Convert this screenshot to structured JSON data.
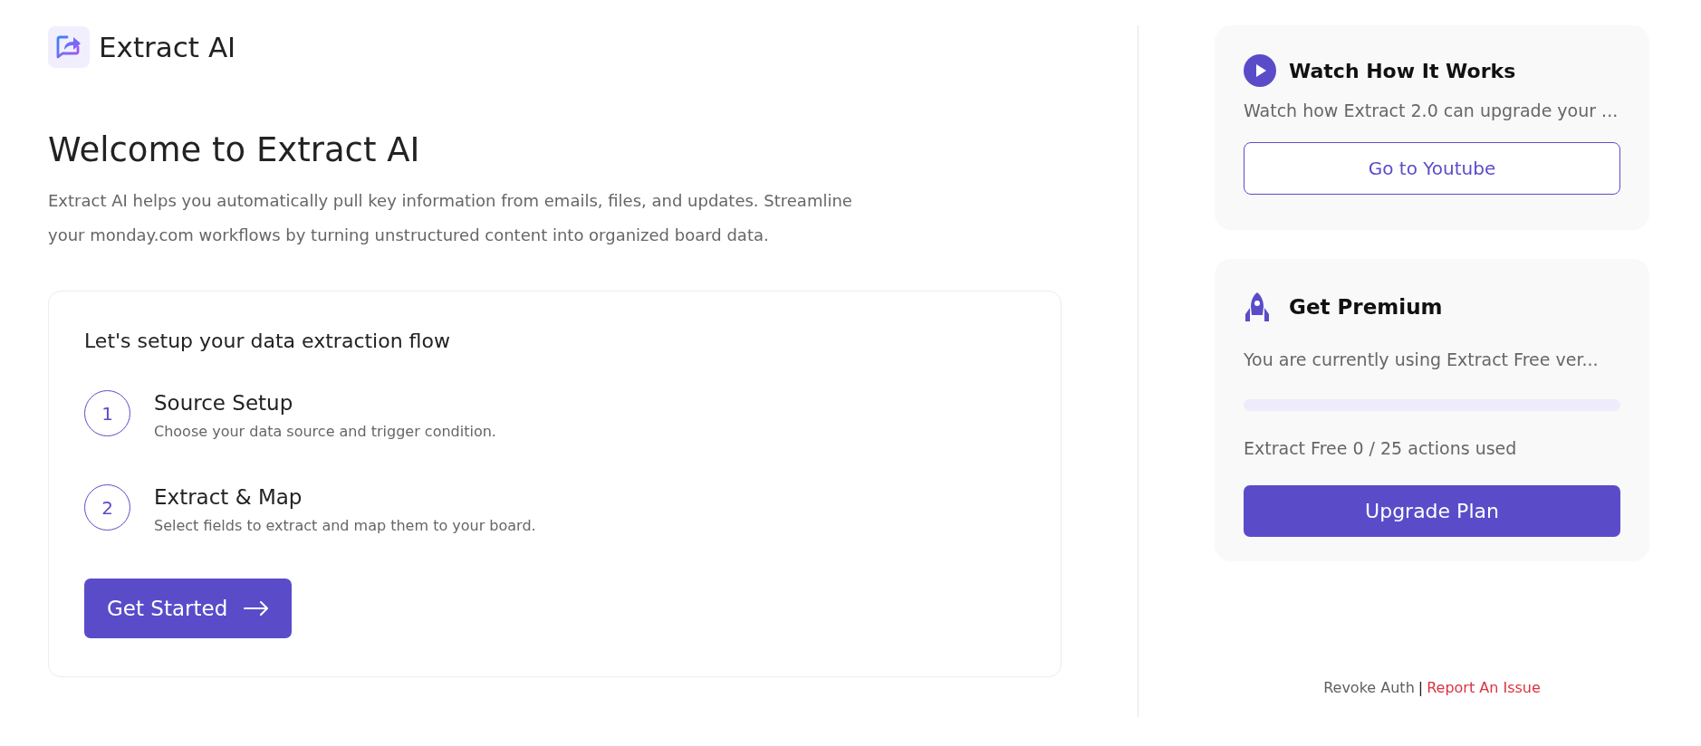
{
  "header": {
    "title": "Extract AI"
  },
  "intro": {
    "heading": "Welcome to Extract AI",
    "description": "Extract AI helps you automatically pull key information from emails, files, and updates. Streamline your monday.com workflows by turning unstructured content into organized board data."
  },
  "setup_card": {
    "title": "Let's setup your data extraction flow",
    "steps": [
      {
        "number": "1",
        "title": "Source Setup",
        "description": "Choose your data source and trigger condition."
      },
      {
        "number": "2",
        "title": "Extract & Map",
        "description": "Select fields to extract and map them to your board."
      }
    ],
    "button": "Get Started"
  },
  "video_card": {
    "title": "Watch How It Works",
    "description": "Watch how Extract 2.0 can upgrade your ...",
    "button": "Go to Youtube"
  },
  "premium_card": {
    "title": "Get Premium",
    "description": "You are currently using Extract Free ver...",
    "usage": {
      "level": 0
    },
    "usage_text": "Extract Free 0 / 25 actions used",
    "button": "Upgrade Plan"
  },
  "footer_links": [
    {
      "label": "Revoke Auth",
      "kind": "plain"
    },
    {
      "label": "|",
      "kind": "separator"
    },
    {
      "label": "Report An Issue",
      "kind": "danger"
    }
  ]
}
